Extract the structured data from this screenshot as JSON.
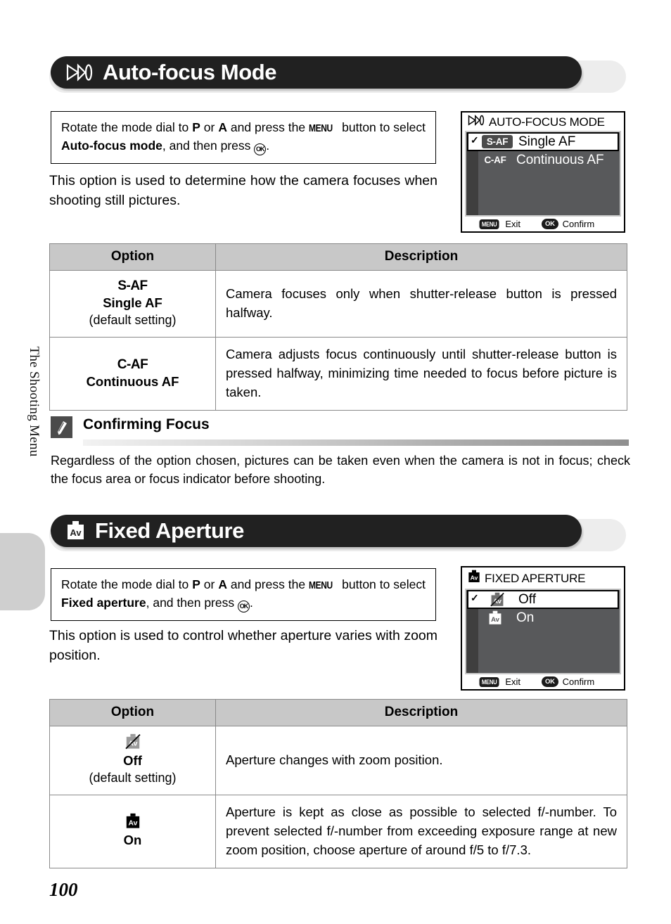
{
  "sidebar": {
    "chapter_label": "The Shooting Menu"
  },
  "page": {
    "number": "100"
  },
  "sections": [
    {
      "id": "auto-focus-mode",
      "icon": "af-arrow-icon",
      "title": "Auto-focus Mode",
      "instruction": {
        "part1": "Rotate the mode dial to ",
        "bold1": "P",
        "part2": " or ",
        "bold2": "A",
        "part3": " and press the ",
        "menu": "MENU",
        "part4": " button to select ",
        "bold3": "Auto-focus mode",
        "part5": ", and then press ",
        "ok": "OK",
        "part6": "."
      },
      "intro": "This option is used to determine how the camera focuses when shooting still pictures.",
      "lcd": {
        "title": "AUTO-FOCUS MODE",
        "title_icon": "af-arrow-icon",
        "rows": [
          {
            "chip": "S-AF",
            "label": "Single AF",
            "selected": true,
            "check": "✓"
          },
          {
            "chip": "C-AF",
            "label": "Continuous AF",
            "selected": false,
            "check": ""
          }
        ],
        "footer": {
          "menu_badge": "MENU",
          "menu_label": "Exit",
          "ok_badge": "OK",
          "ok_label": "Confirm"
        }
      },
      "table": {
        "headers": [
          "Option",
          "Description"
        ],
        "rows": [
          {
            "code": "S-AF",
            "name": "Single AF",
            "default": "(default setting)",
            "description": "Camera focuses only when shutter-release button is pressed halfway."
          },
          {
            "code": "C-AF",
            "name": "Continuous AF",
            "default": "",
            "description": "Camera adjusts focus continuously until shutter-release button is pressed halfway, minimizing time needed to focus before picture is taken."
          }
        ]
      }
    },
    {
      "id": "fixed-aperture",
      "icon": "av-icon",
      "title": "Fixed Aperture",
      "instruction": {
        "part1": "Rotate the mode dial to ",
        "bold1": "P",
        "part2": " or ",
        "bold2": "A",
        "part3": " and press the ",
        "menu": "MENU",
        "part4": " button to select ",
        "bold3": "Fixed aperture",
        "part5": ", and then press ",
        "ok": "OK",
        "part6": "."
      },
      "intro": "This option is used to control whether aperture varies with zoom position.",
      "lcd": {
        "title": "FIXED APERTURE",
        "title_icon": "av-icon",
        "rows": [
          {
            "chip": "",
            "icon": "av-off-icon",
            "label": "Off",
            "selected": true,
            "check": "✓"
          },
          {
            "chip": "",
            "icon": "av-icon",
            "label": "On",
            "selected": false,
            "check": ""
          }
        ],
        "footer": {
          "menu_badge": "MENU",
          "menu_label": "Exit",
          "ok_badge": "OK",
          "ok_label": "Confirm"
        }
      },
      "table": {
        "headers": [
          "Option",
          "Description"
        ],
        "rows": [
          {
            "icon": "av-off-icon",
            "name": "Off",
            "default": "(default setting)",
            "description": "Aperture changes with zoom position."
          },
          {
            "icon": "av-icon",
            "name": "On",
            "default": "",
            "description": "Aperture is kept as close as possible to selected f/-number. To prevent selected f/-number from exceeding exposure range at new zoom position, choose aperture of around f/5 to f/7.3."
          }
        ]
      }
    }
  ],
  "note": {
    "icon": "pencil-icon",
    "title": "Confirming Focus",
    "body": "Regardless of the option chosen, pictures can be taken even when the camera is not in focus; check the focus area or focus indicator before shooting."
  }
}
